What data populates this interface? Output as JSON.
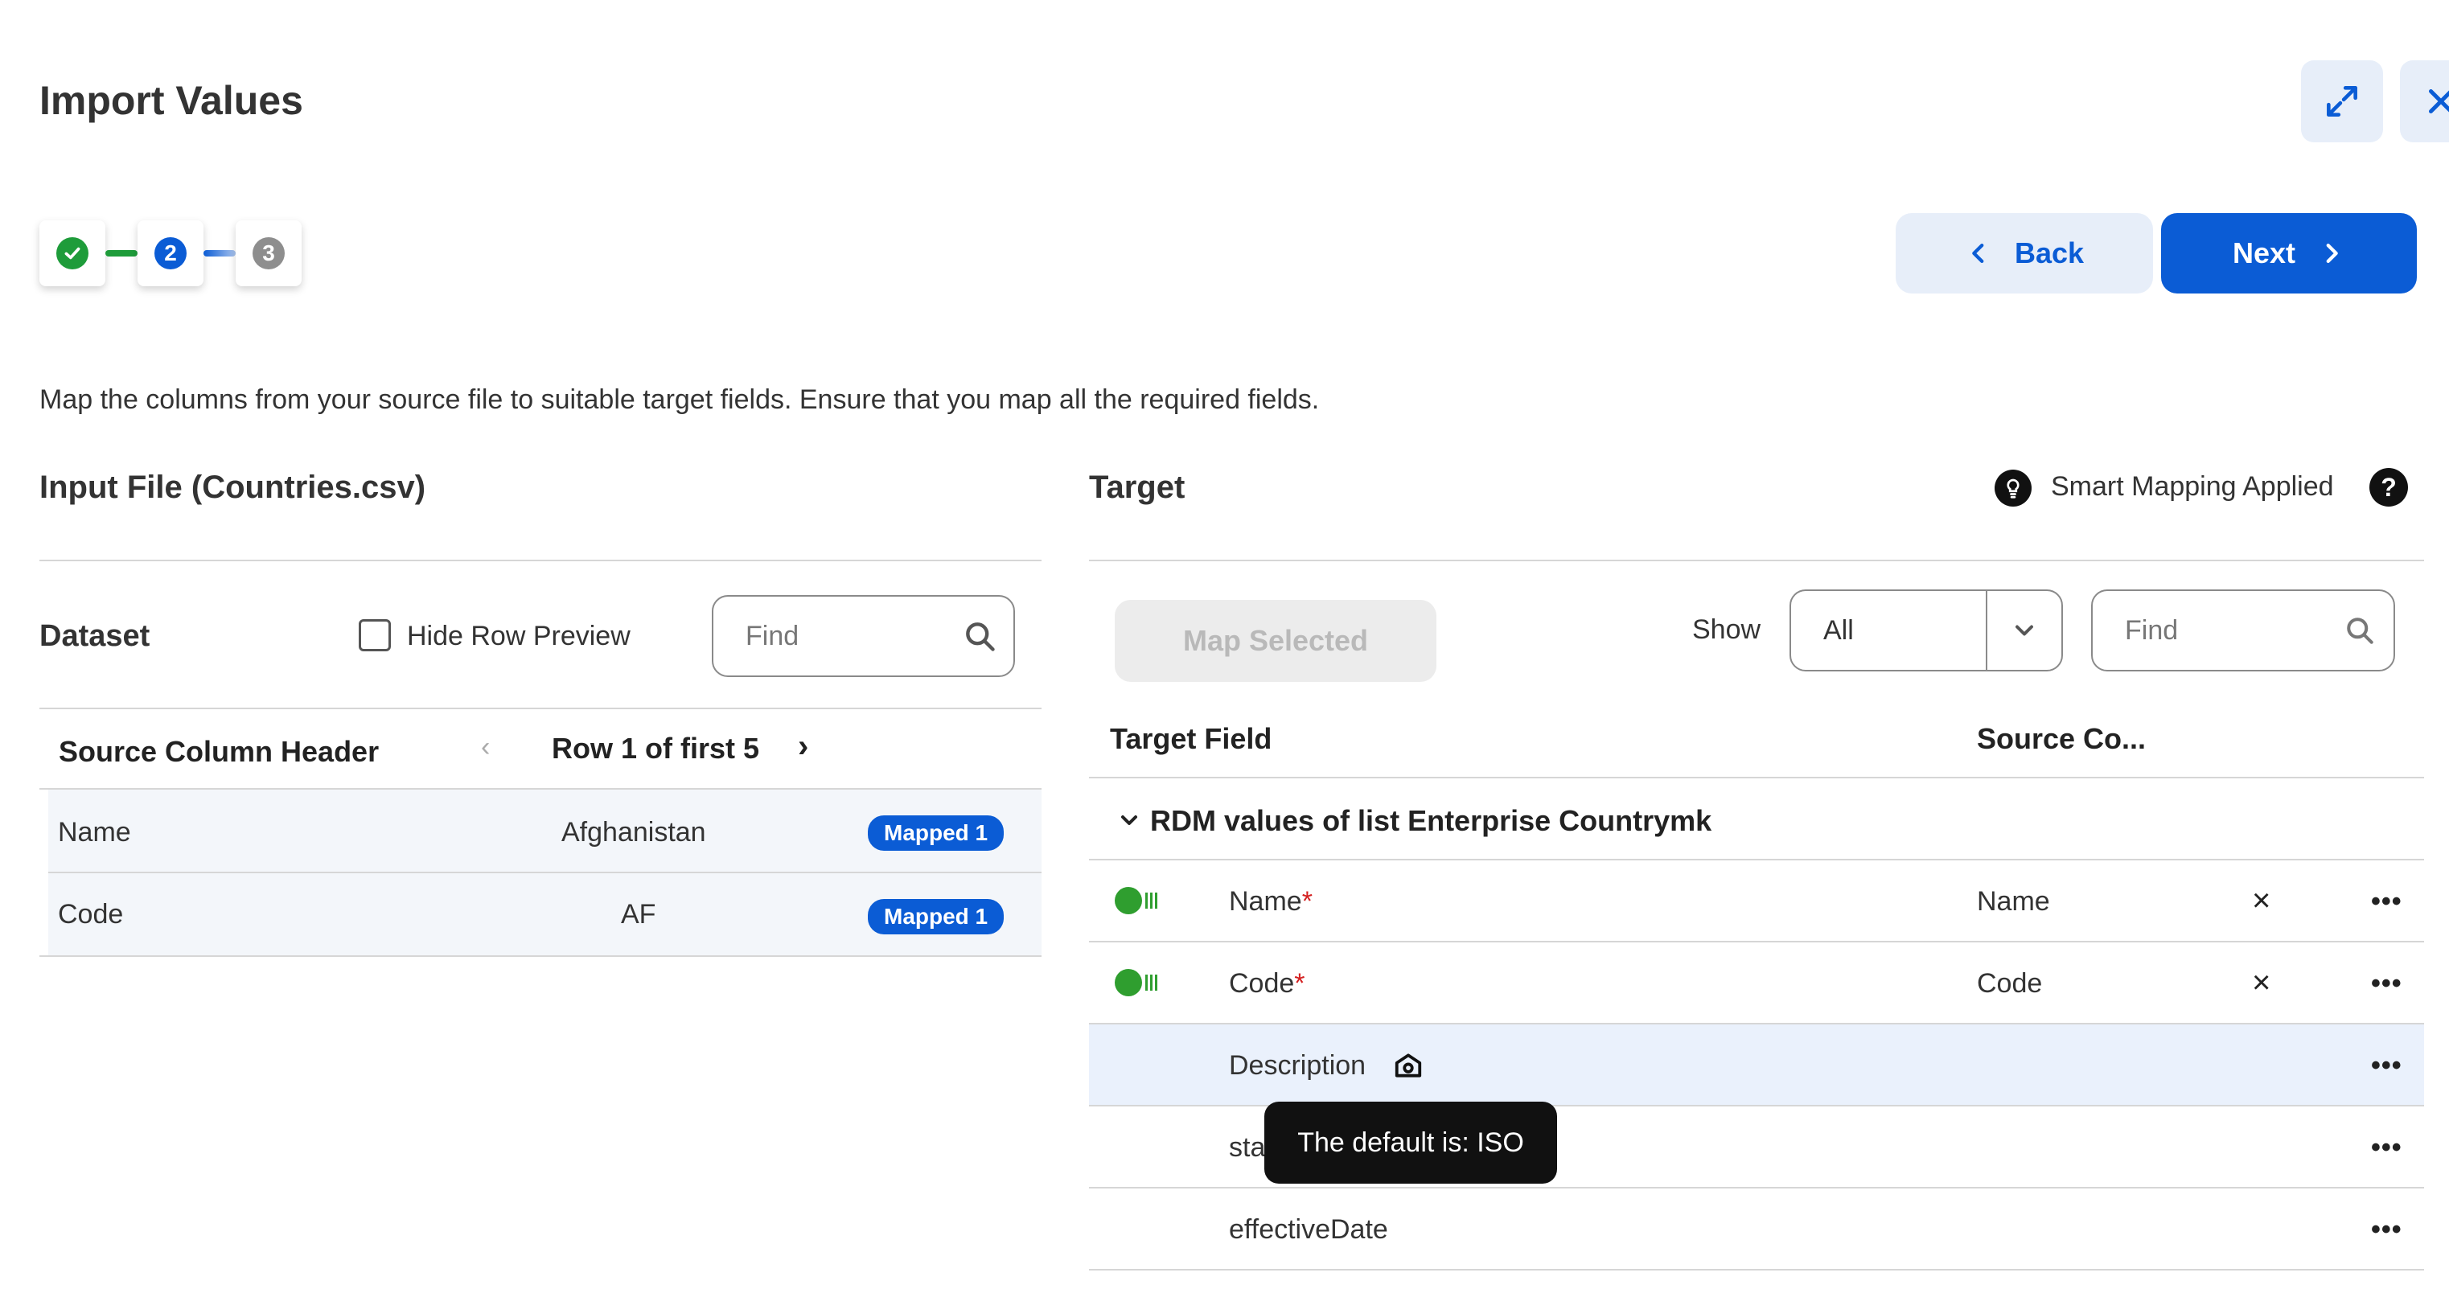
{
  "header": {
    "title": "Import Values",
    "expand_icon": "expand-arrows-icon",
    "close_icon": "close-icon"
  },
  "stepper": {
    "steps": [
      {
        "label": "",
        "state": "complete",
        "color": "#1e9c3a"
      },
      {
        "label": "2",
        "state": "current",
        "color": "#0b5cd5"
      },
      {
        "label": "3",
        "state": "pending",
        "color": "#8e8e8e"
      }
    ]
  },
  "navigation": {
    "back_label": "Back",
    "next_label": "Next"
  },
  "instructions": "Map the columns from your source file to suitable target fields. Ensure that you map all the required fields.",
  "input_file": {
    "title": "Input File (Countries.csv)",
    "dataset_label": "Dataset",
    "hide_row_preview_label": "Hide Row Preview",
    "hide_row_preview_checked": false,
    "find_placeholder": "Find",
    "table": {
      "col_header": "Source Column Header",
      "row_nav": "Row 1 of first 5",
      "rows": [
        {
          "header": "Name",
          "value": "Afghanistan",
          "badge": "Mapped 1"
        },
        {
          "header": "Code",
          "value": "AF",
          "badge": "Mapped 1"
        }
      ]
    }
  },
  "target": {
    "title": "Target",
    "smart_mapping_label": "Smart Mapping Applied",
    "map_selected_label": "Map Selected",
    "show_label": "Show",
    "show_value": "All",
    "find_placeholder": "Find",
    "col_target_field": "Target Field",
    "col_source_column": "Source Co...",
    "group_label": "RDM values of list Enterprise Countrymk",
    "rows": [
      {
        "field": "Name",
        "required": "*",
        "source": "Name",
        "remove": "×",
        "more": "•••"
      },
      {
        "field": "Code",
        "required": "*",
        "source": "Code",
        "remove": "×",
        "more": "•••"
      },
      {
        "field": "Description",
        "more": "•••"
      },
      {
        "field": "sta",
        "more": "•••"
      },
      {
        "field": "effectiveDate",
        "more": "•••"
      }
    ],
    "tooltip": "The default is: ISO"
  },
  "colors": {
    "primary": "#0b5cd5",
    "success": "#1e9c3a",
    "light_blue_bg": "#e7eef9",
    "highlight_row": "#eaf1fc"
  }
}
